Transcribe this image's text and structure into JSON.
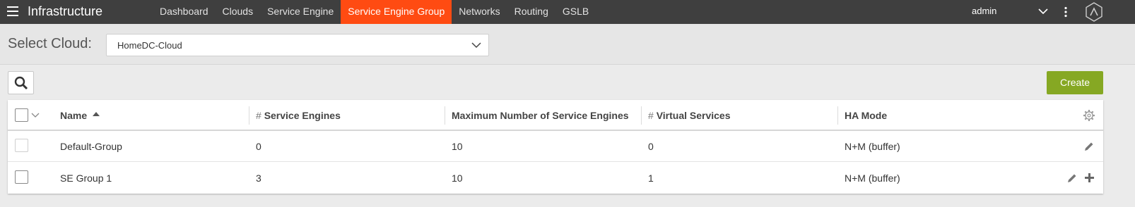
{
  "header": {
    "app_title": "Infrastructure",
    "nav": [
      "Dashboard",
      "Clouds",
      "Service Engine",
      "Service Engine Group",
      "Networks",
      "Routing",
      "GSLB"
    ],
    "active_nav": "Service Engine Group",
    "user": "admin"
  },
  "cloud": {
    "label": "Select Cloud:",
    "selected": "HomeDC-Cloud"
  },
  "toolbar": {
    "create_label": "Create"
  },
  "table": {
    "columns": {
      "name": "Name",
      "service_engines": "Service Engines",
      "max_service_engines": "Maximum Number of Service Engines",
      "virtual_services": "Virtual Services",
      "ha_mode": "HA Mode"
    },
    "hash": "#",
    "rows": [
      {
        "name": "Default-Group",
        "service_engines": "0",
        "max_service_engines": "10",
        "virtual_services": "0",
        "ha_mode": "N+M (buffer)"
      },
      {
        "name": "SE Group 1",
        "service_engines": "3",
        "max_service_engines": "10",
        "virtual_services": "1",
        "ha_mode": "N+M (buffer)"
      }
    ]
  },
  "colors": {
    "topbar": "#3f3f3f",
    "active_tab": "#ff4b12",
    "create_button": "#86a823"
  },
  "icons": [
    "menu-icon",
    "chevron-down-icon",
    "kebab-icon",
    "avi-logo-icon",
    "search-icon",
    "sort-asc-icon",
    "gear-icon",
    "pencil-icon",
    "plus-icon"
  ]
}
